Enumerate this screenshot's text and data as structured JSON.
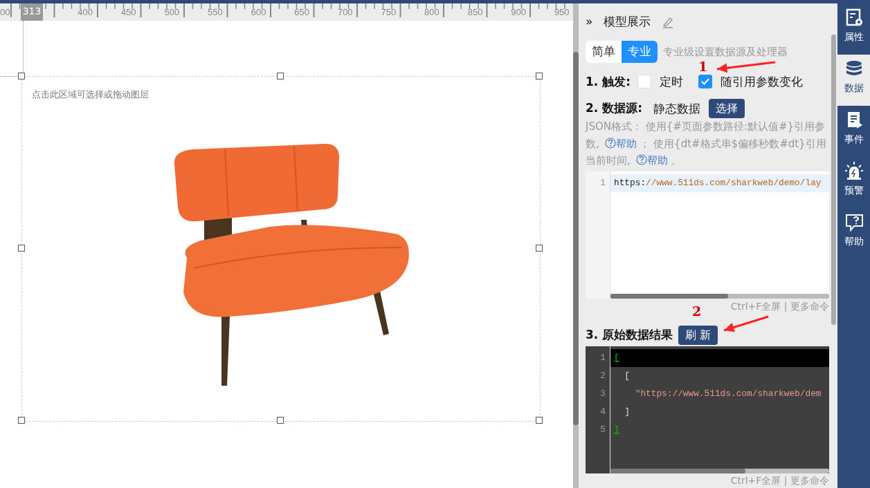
{
  "ruler": {
    "marker": "313",
    "labels": [
      "00",
      "400",
      "450",
      "500",
      "550",
      "600",
      "650",
      "700",
      "750",
      "800",
      "850",
      "900",
      "950"
    ]
  },
  "canvas": {
    "hint": "点击此区域可选择或拖动图层"
  },
  "panel": {
    "collapse": "»",
    "title": "模型展示",
    "mode_tabs": [
      {
        "label": "简单",
        "selected": false
      },
      {
        "label": "专业",
        "selected": true
      }
    ],
    "mode_hint": "专业级设置数据源及处理器",
    "trigger": {
      "label": "1. 触发:",
      "options": [
        {
          "label": "定时",
          "checked": false
        },
        {
          "label": "随引用参数变化",
          "checked": true
        }
      ]
    },
    "source": {
      "label": "2. 数据源:",
      "value": "静态数据",
      "button": "选择"
    },
    "help": [
      {
        "kind": "text",
        "text": "JSON格式： 使用{#页面参数路径:默认值#}引用参数, "
      },
      {
        "kind": "link",
        "text": "帮助"
      },
      {
        "kind": "text",
        "text": " ； 使用{dt#格式串$偏移秒数#dt}引用当前时间, "
      },
      {
        "kind": "link",
        "text": "帮助"
      },
      {
        "kind": "text",
        "text": " 。"
      }
    ],
    "source_editor": {
      "lines": [
        {
          "number": "1",
          "active": true,
          "tokens": [
            {
              "kind": "plain",
              "text": "https:"
            },
            {
              "kind": "string",
              "text": "//www.511ds.com/sharkweb/demo/lay"
            }
          ]
        }
      ],
      "footer": "Ctrl+F全屏 | 更多命令"
    },
    "result": {
      "label": "3. 原始数据结果",
      "button": "刷 新"
    },
    "result_editor": {
      "lines": [
        {
          "number": "1",
          "active": true,
          "tokens": [
            {
              "kind": "match",
              "text": "["
            }
          ]
        },
        {
          "number": "2",
          "active": false,
          "tokens": [
            {
              "kind": "plain",
              "text": "  ["
            }
          ]
        },
        {
          "number": "3",
          "active": false,
          "tokens": [
            {
              "kind": "string",
              "text": "    \"https://www.511ds.com/sharkweb/dem"
            }
          ]
        },
        {
          "number": "4",
          "active": false,
          "tokens": [
            {
              "kind": "plain",
              "text": "  ]"
            }
          ]
        },
        {
          "number": "5",
          "active": false,
          "tokens": [
            {
              "kind": "match",
              "text": "]"
            }
          ]
        }
      ],
      "footer": "Ctrl+F全屏 | 更多命令"
    }
  },
  "sidebar": {
    "items": [
      {
        "kind": "properties",
        "label": "属性",
        "selected": false
      },
      {
        "kind": "data",
        "label": "数据",
        "selected": true
      },
      {
        "kind": "events",
        "label": "事件",
        "selected": false
      },
      {
        "kind": "alert",
        "label": "预警",
        "selected": false
      },
      {
        "kind": "help",
        "label": "帮助",
        "selected": false
      }
    ]
  },
  "annotations": [
    {
      "label": "1"
    },
    {
      "label": "2"
    }
  ]
}
